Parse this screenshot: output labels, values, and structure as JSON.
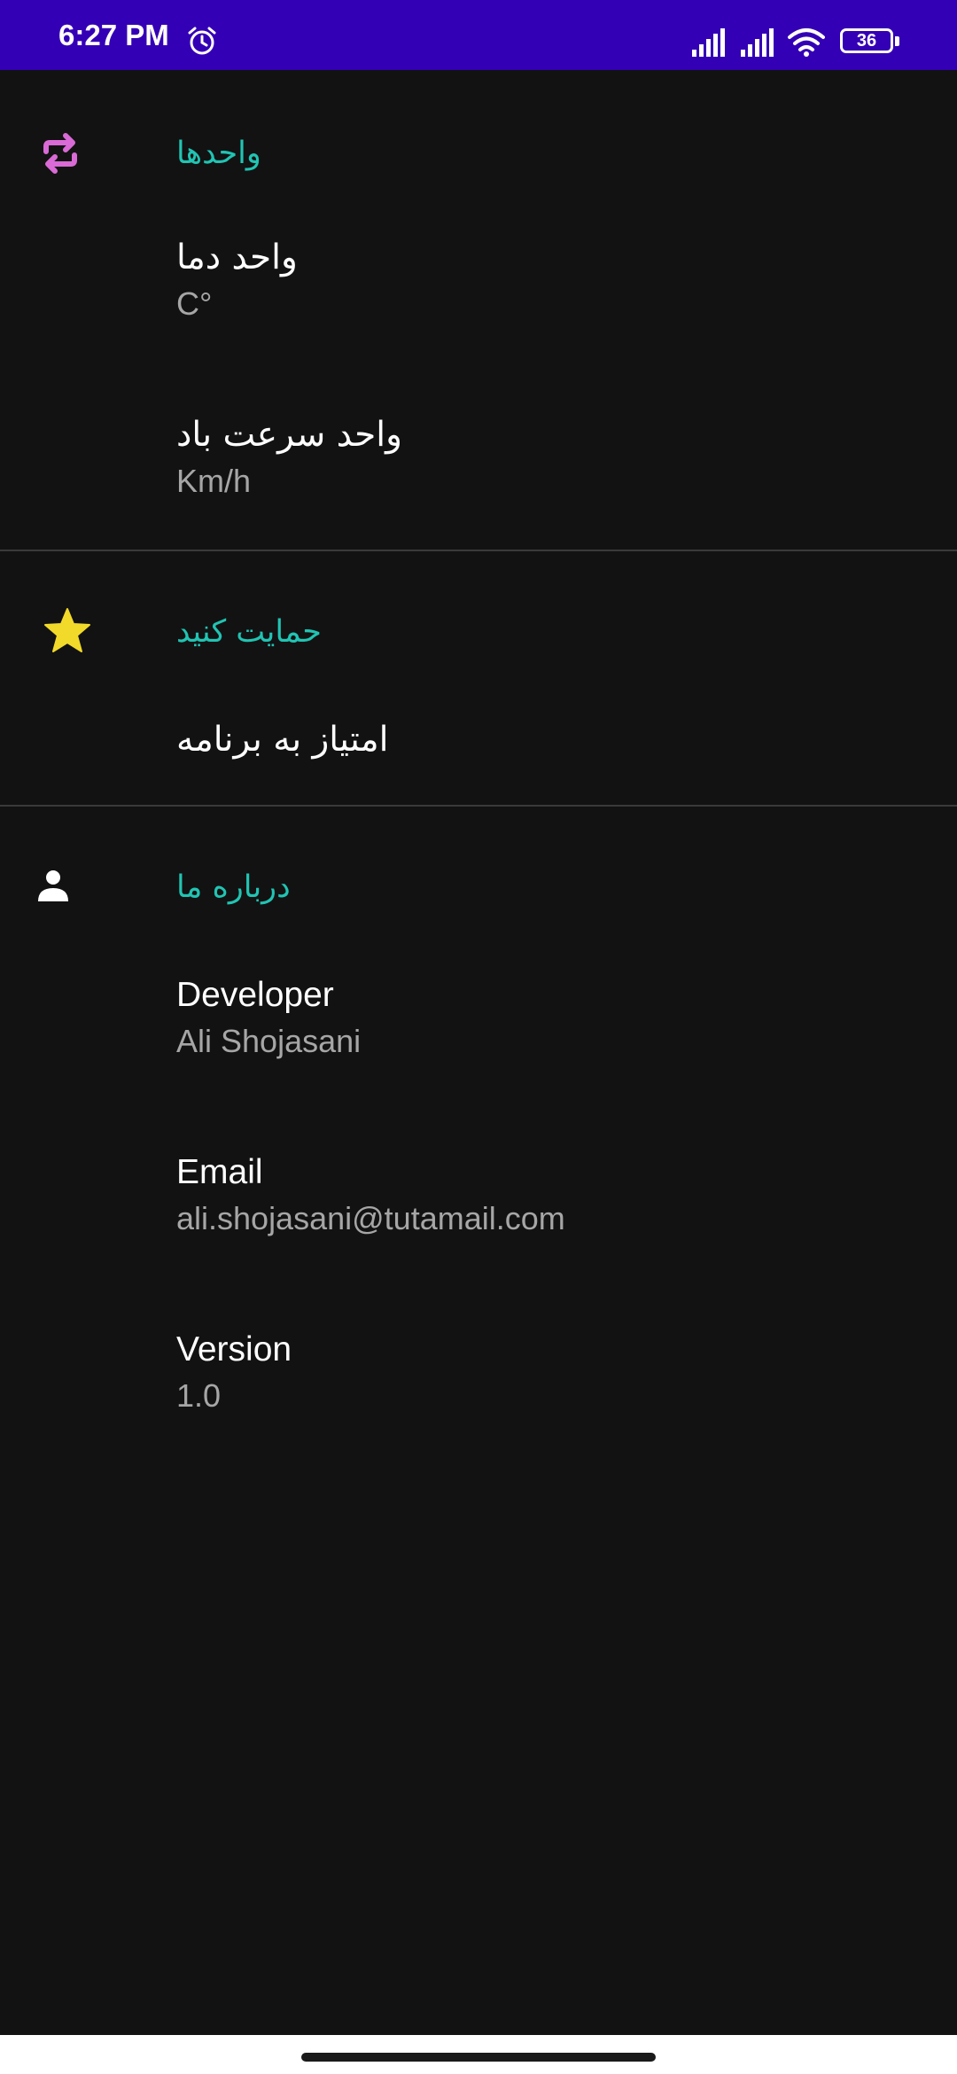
{
  "status_bar": {
    "time": "6:27 PM",
    "battery": "36",
    "background": "#3400b5",
    "icons": [
      "alarm-icon",
      "signal-icon",
      "signal-icon",
      "wifi-icon",
      "battery-icon"
    ]
  },
  "colors": {
    "background": "#121212",
    "section_header": "#21c4b3",
    "title": "#ffffff",
    "summary": "#a6a6a6",
    "units_icon": "#d96ad6",
    "star_icon": "#f2da2a",
    "person_icon": "#ffffff"
  },
  "sections": {
    "units": {
      "header": "واحدها",
      "icon": "repeat-icon",
      "items": [
        {
          "title": "واحد دما",
          "summary": "C°"
        },
        {
          "title": "واحد سرعت باد",
          "summary": "Km/h"
        }
      ]
    },
    "support": {
      "header": "حمایت کنید",
      "icon": "star-icon",
      "items": [
        {
          "title": "امتیاز به برنامه"
        }
      ]
    },
    "about": {
      "header": "درباره ما",
      "icon": "person-icon",
      "items": [
        {
          "title": "Developer",
          "summary": "Ali Shojasani"
        },
        {
          "title": "Email",
          "summary": "ali.shojasani@tutamail.com"
        },
        {
          "title": "Version",
          "summary": "1.0"
        }
      ]
    }
  }
}
